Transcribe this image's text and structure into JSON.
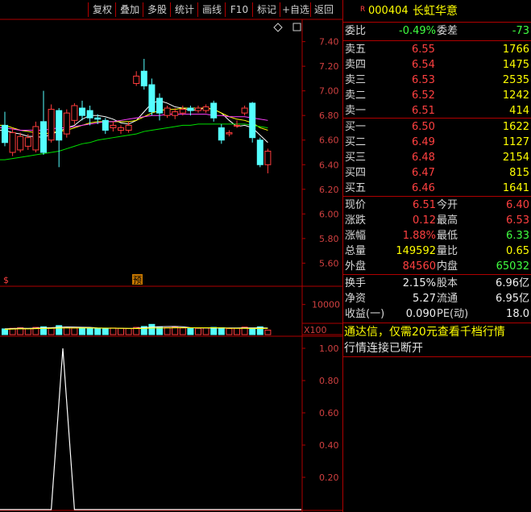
{
  "toolbar": {
    "buttons": [
      "复权",
      "叠加",
      "多股",
      "统计",
      "画线",
      "F10",
      "标记",
      "+自选",
      "返回"
    ]
  },
  "stock": {
    "badge": "R",
    "code": "000404",
    "name": "长虹华意"
  },
  "committee": {
    "ratio_label": "委比",
    "ratio_value": "-0.49%",
    "diff_label": "委差",
    "diff_value": "-73"
  },
  "asks": [
    {
      "label": "卖五",
      "price": "6.55",
      "volume": "1766"
    },
    {
      "label": "卖四",
      "price": "6.54",
      "volume": "1475"
    },
    {
      "label": "卖三",
      "price": "6.53",
      "volume": "2535"
    },
    {
      "label": "卖二",
      "price": "6.52",
      "volume": "1242"
    },
    {
      "label": "卖一",
      "price": "6.51",
      "volume": "414"
    }
  ],
  "bids": [
    {
      "label": "买一",
      "price": "6.50",
      "volume": "1622"
    },
    {
      "label": "买二",
      "price": "6.49",
      "volume": "1127"
    },
    {
      "label": "买三",
      "price": "6.48",
      "volume": "2154"
    },
    {
      "label": "买四",
      "price": "6.47",
      "volume": "815"
    },
    {
      "label": "买五",
      "price": "6.46",
      "volume": "1641"
    }
  ],
  "stats": [
    {
      "l1": "现价",
      "v1": "6.51",
      "c1": "red",
      "l2": "今开",
      "v2": "6.40",
      "c2": "red"
    },
    {
      "l1": "涨跌",
      "v1": "0.12",
      "c1": "red",
      "l2": "最高",
      "v2": "6.53",
      "c2": "red"
    },
    {
      "l1": "涨幅",
      "v1": "1.88%",
      "c1": "red",
      "l2": "最低",
      "v2": "6.33",
      "c2": "green"
    },
    {
      "l1": "总量",
      "v1": "149592",
      "c1": "yellow",
      "l2": "量比",
      "v2": "0.65",
      "c2": "yellow"
    },
    {
      "l1": "外盘",
      "v1": "84560",
      "c1": "red",
      "l2": "内盘",
      "v2": "65032",
      "c2": "green"
    }
  ],
  "fundamentals": [
    {
      "l1": "换手",
      "v1": "2.15%",
      "l2": "股本",
      "v2": "6.96亿"
    },
    {
      "l1": "净资",
      "v1": "5.27",
      "l2": "流通",
      "v2": "6.95亿"
    },
    {
      "l1": "收益(一)",
      "v1": "0.090",
      "l2": "PE(动)",
      "v2": "18.0"
    }
  ],
  "promo_text": "通达信，仅需20元查看千档行情",
  "status_text": "行情连接已断开",
  "chart_markers": {
    "left_marker": "$",
    "forecast_marker": "预"
  },
  "colors": {
    "up": "#ff3c3c",
    "down": "#54ffff",
    "panel_border": "#b00000"
  },
  "chart_data": [
    {
      "type": "candlestick",
      "y_ticks": [
        "7.40",
        "7.20",
        "7.00",
        "6.80",
        "6.60",
        "6.40",
        "6.20",
        "6.00",
        "5.80",
        "5.60"
      ],
      "ylim": [
        5.55,
        7.45
      ],
      "candles": [
        {
          "o": 6.72,
          "c": 6.58,
          "h": 6.83,
          "l": 6.55
        },
        {
          "o": 6.5,
          "c": 6.66,
          "h": 6.7,
          "l": 6.47
        },
        {
          "o": 6.52,
          "c": 6.63,
          "h": 6.66,
          "l": 6.5
        },
        {
          "o": 6.55,
          "c": 6.62,
          "h": 6.65,
          "l": 6.52
        },
        {
          "o": 6.52,
          "c": 6.71,
          "h": 6.75,
          "l": 6.5
        },
        {
          "o": 6.75,
          "c": 6.5,
          "h": 7.0,
          "l": 6.48
        },
        {
          "o": 6.6,
          "c": 6.85,
          "h": 6.89,
          "l": 6.58
        },
        {
          "o": 6.84,
          "c": 6.6,
          "h": 6.86,
          "l": 6.38
        },
        {
          "o": 6.65,
          "c": 6.82,
          "h": 6.85,
          "l": 6.62
        },
        {
          "o": 6.76,
          "c": 6.88,
          "h": 6.9,
          "l": 6.73
        },
        {
          "o": 6.86,
          "c": 6.8,
          "h": 6.92,
          "l": 6.76
        },
        {
          "o": 6.84,
          "c": 6.78,
          "h": 6.88,
          "l": 6.72
        },
        {
          "o": 6.78,
          "c": 6.77,
          "h": 6.81,
          "l": 6.73
        },
        {
          "o": 6.76,
          "c": 6.68,
          "h": 6.78,
          "l": 6.65
        },
        {
          "o": 6.7,
          "c": 6.72,
          "h": 6.75,
          "l": 6.67
        },
        {
          "o": 6.68,
          "c": 6.7,
          "h": 6.72,
          "l": 6.65
        },
        {
          "o": 6.68,
          "c": 6.72,
          "h": 6.75,
          "l": 6.66
        },
        {
          "o": 7.06,
          "c": 7.12,
          "h": 7.16,
          "l": 7.04
        },
        {
          "o": 7.16,
          "c": 7.04,
          "h": 7.26,
          "l": 7.01
        },
        {
          "o": 7.05,
          "c": 6.83,
          "h": 7.1,
          "l": 6.8
        },
        {
          "o": 6.94,
          "c": 6.82,
          "h": 6.98,
          "l": 6.76
        },
        {
          "o": 6.8,
          "c": 6.86,
          "h": 6.88,
          "l": 6.78
        },
        {
          "o": 6.8,
          "c": 6.83,
          "h": 6.86,
          "l": 6.77
        },
        {
          "o": 6.82,
          "c": 6.85,
          "h": 6.88,
          "l": 6.8
        },
        {
          "o": 6.86,
          "c": 6.84,
          "h": 6.88,
          "l": 6.8
        },
        {
          "o": 6.84,
          "c": 6.86,
          "h": 6.88,
          "l": 6.82
        },
        {
          "o": 6.84,
          "c": 6.87,
          "h": 6.89,
          "l": 6.82
        },
        {
          "o": 6.9,
          "c": 6.78,
          "h": 6.92,
          "l": 6.75
        },
        {
          "o": 6.7,
          "c": 6.6,
          "h": 6.73,
          "l": 6.57
        },
        {
          "o": 6.65,
          "c": 6.66,
          "h": 6.68,
          "l": 6.63
        },
        {
          "o": 6.72,
          "c": 6.72,
          "h": 6.76,
          "l": 6.7
        },
        {
          "o": 6.82,
          "c": 6.86,
          "h": 6.88,
          "l": 6.8
        },
        {
          "o": 6.9,
          "c": 6.62,
          "h": 6.91,
          "l": 6.58
        },
        {
          "o": 6.6,
          "c": 6.4,
          "h": 6.62,
          "l": 6.38
        },
        {
          "o": 6.4,
          "c": 6.51,
          "h": 6.53,
          "l": 6.33
        }
      ],
      "ma_lines": [
        {
          "color": "#ffffff",
          "values": [
            6.68,
            6.66,
            6.65,
            6.63,
            6.63,
            6.62,
            6.65,
            6.67,
            6.7,
            6.72,
            6.77,
            6.8,
            6.8,
            6.79,
            6.77,
            6.74,
            6.73,
            6.76,
            6.83,
            6.9,
            6.92,
            6.9,
            6.87,
            6.86,
            6.84,
            6.85,
            6.86,
            6.85,
            6.82,
            6.76,
            6.71,
            6.72,
            6.7,
            6.64,
            6.58
          ]
        },
        {
          "color": "#ffff00",
          "values": [
            6.72,
            6.7,
            6.68,
            6.67,
            6.66,
            6.65,
            6.66,
            6.67,
            6.68,
            6.7,
            6.72,
            6.74,
            6.75,
            6.75,
            6.75,
            6.75,
            6.75,
            6.76,
            6.79,
            6.82,
            6.84,
            6.85,
            6.85,
            6.86,
            6.86,
            6.86,
            6.86,
            6.85,
            6.82,
            6.79,
            6.77,
            6.76,
            6.74,
            6.7,
            6.68
          ]
        },
        {
          "color": "#ff40ff",
          "values": [
            6.7,
            6.69,
            6.68,
            6.68,
            6.68,
            6.68,
            6.69,
            6.7,
            6.7,
            6.71,
            6.72,
            6.73,
            6.74,
            6.75,
            6.75,
            6.76,
            6.77,
            6.78,
            6.79,
            6.8,
            6.8,
            6.81,
            6.81,
            6.81,
            6.81,
            6.81,
            6.81,
            6.8,
            6.8,
            6.79,
            6.79,
            6.79,
            6.78,
            6.77,
            6.76
          ]
        },
        {
          "color": "#00e000",
          "values": [
            6.44,
            6.45,
            6.46,
            6.47,
            6.48,
            6.49,
            6.5,
            6.51,
            6.53,
            6.55,
            6.57,
            6.58,
            6.6,
            6.61,
            6.62,
            6.63,
            6.64,
            6.65,
            6.67,
            6.68,
            6.69,
            6.7,
            6.71,
            6.72,
            6.72,
            6.73,
            6.73,
            6.73,
            6.73,
            6.73,
            6.73,
            6.73,
            6.72,
            6.71,
            6.7
          ]
        }
      ]
    },
    {
      "type": "bar",
      "y_ticks": [
        "10000"
      ],
      "unit_label": "X100",
      "ylim": [
        0,
        15000
      ],
      "values": [
        1900,
        2100,
        2300,
        2000,
        2400,
        2600,
        2200,
        3000,
        2500,
        2200,
        2300,
        2100,
        2000,
        1900,
        2200,
        2100,
        2000,
        2400,
        2700,
        3400,
        2600,
        2300,
        2500,
        2200,
        2000,
        2100,
        2200,
        2400,
        2300,
        2000,
        2100,
        2500,
        2200,
        2600,
        1500
      ]
    },
    {
      "type": "line",
      "y_ticks": [
        "1.00",
        "0.80",
        "0.60",
        "0.40",
        "0.20"
      ],
      "ylim": [
        0,
        1.05
      ],
      "values": [
        0,
        0,
        0,
        0,
        0,
        0,
        0,
        0,
        0,
        0,
        0,
        1.0,
        0,
        0,
        0,
        0,
        0,
        0,
        0,
        0,
        0,
        0,
        0,
        0,
        0,
        0,
        0,
        0,
        0,
        0,
        0,
        0,
        0,
        0,
        0
      ]
    }
  ]
}
